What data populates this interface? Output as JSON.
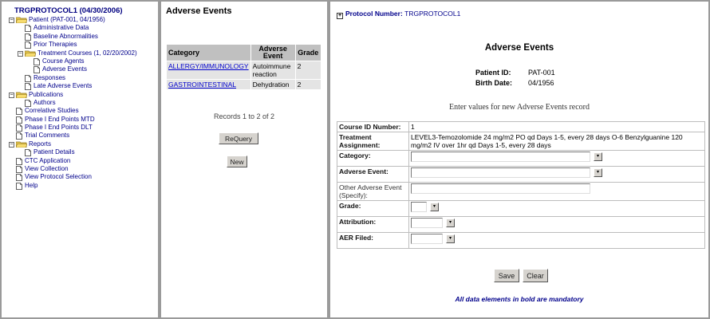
{
  "left": {
    "title": "TRGPROTOCOL1 (04/30/2006)",
    "tree": [
      {
        "label": "Patient (PAT-001, 04/1956)",
        "icon": "folder-icon",
        "depth": 0,
        "expander": "minus"
      },
      {
        "label": "Administrative Data",
        "icon": "page-icon",
        "depth": 1
      },
      {
        "label": "Baseline Abnormalities",
        "icon": "page-icon",
        "depth": 1
      },
      {
        "label": "Prior Therapies",
        "icon": "page-icon",
        "depth": 1
      },
      {
        "label": "Treatment Courses (1, 02/20/2002)",
        "icon": "folder-icon",
        "depth": 1,
        "expander": "minus"
      },
      {
        "label": "Course Agents",
        "icon": "page-icon",
        "depth": 2
      },
      {
        "label": "Adverse Events",
        "icon": "page-icon",
        "depth": 2
      },
      {
        "label": "Responses",
        "icon": "page-icon",
        "depth": 1
      },
      {
        "label": "Late Adverse Events",
        "icon": "page-icon",
        "depth": 1
      },
      {
        "label": "Publications",
        "icon": "folder-icon",
        "depth": 0,
        "expander": "minus"
      },
      {
        "label": "Authors",
        "icon": "page-icon",
        "depth": 1
      },
      {
        "label": "Correlative Studies",
        "icon": "page-icon",
        "depth": 0
      },
      {
        "label": "Phase I End Points MTD",
        "icon": "page-icon",
        "depth": 0
      },
      {
        "label": "Phase I End Points DLT",
        "icon": "page-icon",
        "depth": 0
      },
      {
        "label": "Trial Comments",
        "icon": "page-icon",
        "depth": 0
      },
      {
        "label": "Reports",
        "icon": "folder-icon",
        "depth": 0,
        "expander": "minus"
      },
      {
        "label": "Patient Details",
        "icon": "page-icon",
        "depth": 1
      },
      {
        "label": "CTC Application",
        "icon": "page-icon",
        "depth": 0
      },
      {
        "label": "View Collection",
        "icon": "page-icon",
        "depth": 0
      },
      {
        "label": "View Protocol Selection",
        "icon": "page-icon",
        "depth": 0
      },
      {
        "label": "Help",
        "icon": "page-icon",
        "depth": 0
      }
    ]
  },
  "middle": {
    "title": "Adverse Events",
    "columns": [
      "Category",
      "Adverse Event",
      "Grade"
    ],
    "rows": [
      {
        "category": "ALLERGY/IMMUNOLOGY",
        "event": "Autoimmune reaction",
        "grade": "2"
      },
      {
        "category": "GASTROINTESTINAL",
        "event": "Dehydration",
        "grade": "2"
      }
    ],
    "records": "Records 1 to 2 of 2",
    "requery_label": "ReQuery",
    "new_label": "New"
  },
  "right": {
    "expand_glyph": "+",
    "protocol_label": "Protocol Number:",
    "protocol_value": "TRGPROTOCOL1",
    "title": "Adverse Events",
    "patient_id_label": "Patient ID:",
    "patient_id": "PAT-001",
    "birth_date_label": "Birth Date:",
    "birth_date": "04/1956",
    "enter_text": "Enter values for new Adverse Events record",
    "form": {
      "course_id_label": "Course ID Number:",
      "course_id": "1",
      "treatment_label": "Treatment Assignment:",
      "treatment": "LEVEL3-Temozolomide 24 mg/m2 PO qd Days 1-5, every 28 days O-6 Benzylguanine 120 mg/m2 IV over 1hr qd Days 1-5, every 28 days",
      "category_label": "Category:",
      "adverse_event_label": "Adverse Event:",
      "other_label": "Other Adverse Event (Specify):",
      "grade_label": "Grade:",
      "attribution_label": "Attribution:",
      "aer_label": "AER Filed:"
    },
    "save_label": "Save",
    "clear_label": "Clear",
    "mandatory_note": "All data elements in bold are mandatory"
  }
}
